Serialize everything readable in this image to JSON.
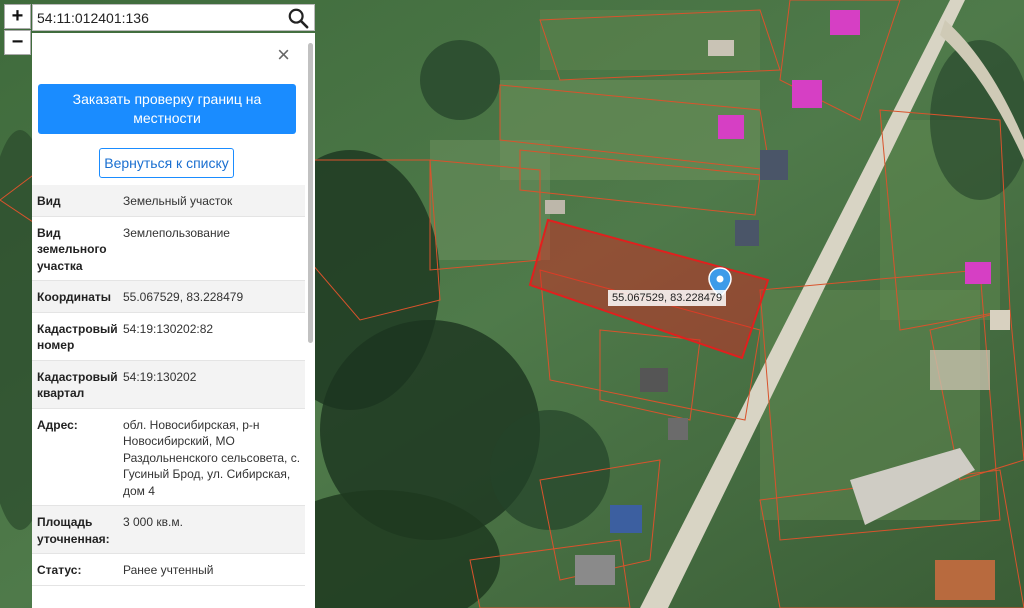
{
  "search": {
    "value": "54:11:012401:136"
  },
  "zoom": {
    "in_label": "+",
    "out_label": "−"
  },
  "panel": {
    "close_label": "×",
    "order_button": "Заказать проверку границ на местности",
    "back_button": "Вернуться к списку",
    "rows": [
      {
        "key": "Вид",
        "value": "Земельный участок"
      },
      {
        "key": "Вид земельного участка",
        "value": "Землепользование"
      },
      {
        "key": "Координаты",
        "value": "55.067529, 83.228479"
      },
      {
        "key": "Кадастровый номер",
        "value": "54:19:130202:82"
      },
      {
        "key": "Кадастровый квартал",
        "value": "54:19:130202"
      },
      {
        "key": "Адрес:",
        "value": "обл. Новосибирская, р-н Новосибирский, МО Раздольненского сельсовета, с. Гусиный Брод, ул. Сибирская, дом 4"
      },
      {
        "key": "Площадь уточненная:",
        "value": "3 000 кв.м."
      },
      {
        "key": "Статус:",
        "value": "Ранее учтенный"
      }
    ]
  },
  "map": {
    "marker_label": "55.067529, 83.228479",
    "parcel_fill": "#e0201e",
    "boundary_color": "#d9532c",
    "road_color": "#d8d4c4",
    "roof_color": "#d63fc4"
  }
}
